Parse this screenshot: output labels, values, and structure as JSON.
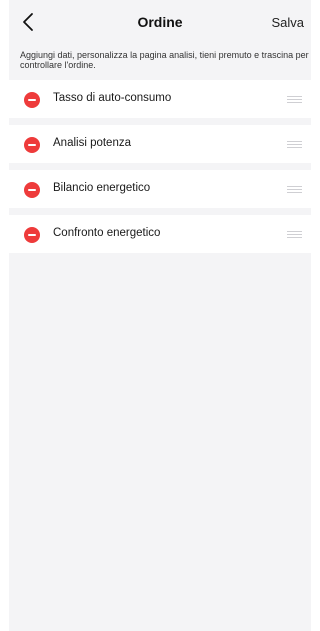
{
  "header": {
    "back_icon": "chevron-left-icon",
    "title": "Ordine",
    "save_label": "Salva"
  },
  "hint": "Aggiungi dati, personalizza la pagina analisi, tieni premuto e trascina per controllare l'ordine.",
  "items": [
    {
      "label": "Tasso di auto-consumo"
    },
    {
      "label": "Analisi potenza"
    },
    {
      "label": "Bilancio energetico"
    },
    {
      "label": "Confronto energetico"
    }
  ],
  "colors": {
    "remove": "#ee3b3b",
    "background": "#f4f4f6",
    "row": "#ffffff"
  }
}
